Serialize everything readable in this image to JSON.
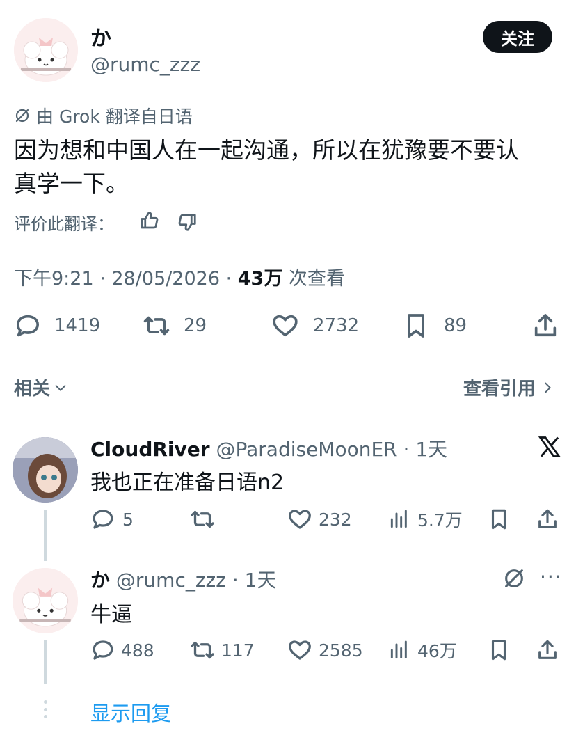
{
  "post": {
    "display_name": "か",
    "handle": "@rumc_zzz",
    "follow_label": "关注",
    "translated_by": "由 Grok 翻译自日语",
    "text_line1": "因为想和中国人在一起沟通，所以在犹豫要不要认",
    "text_line2": "真学一下。",
    "rate_label": "评价此翻译：",
    "time": "下午9:21 · 28/05/2026 · ",
    "views": "43万",
    "views_suffix": " 次查看",
    "replies": "1419",
    "reposts": "29",
    "likes": "2732",
    "bookmarks": "89",
    "related_label": "相关",
    "quotes_label": "查看引用"
  },
  "replies": [
    {
      "name": "CloudRiver",
      "handle": "@ParadiseMoonER · 1天",
      "text": "我也正在准备日语n2",
      "replies": "5",
      "reposts": "",
      "likes": "232",
      "views": "5.7万"
    },
    {
      "name": "か",
      "handle": "@rumc_zzz · 1天",
      "text": "牛逼",
      "replies": "488",
      "reposts": "117",
      "likes": "2585",
      "views": "46万"
    }
  ],
  "show_replies_label": "显示回复",
  "colors": {
    "link": "#1d9bf0",
    "muted": "#536471",
    "text": "#0f1419"
  }
}
